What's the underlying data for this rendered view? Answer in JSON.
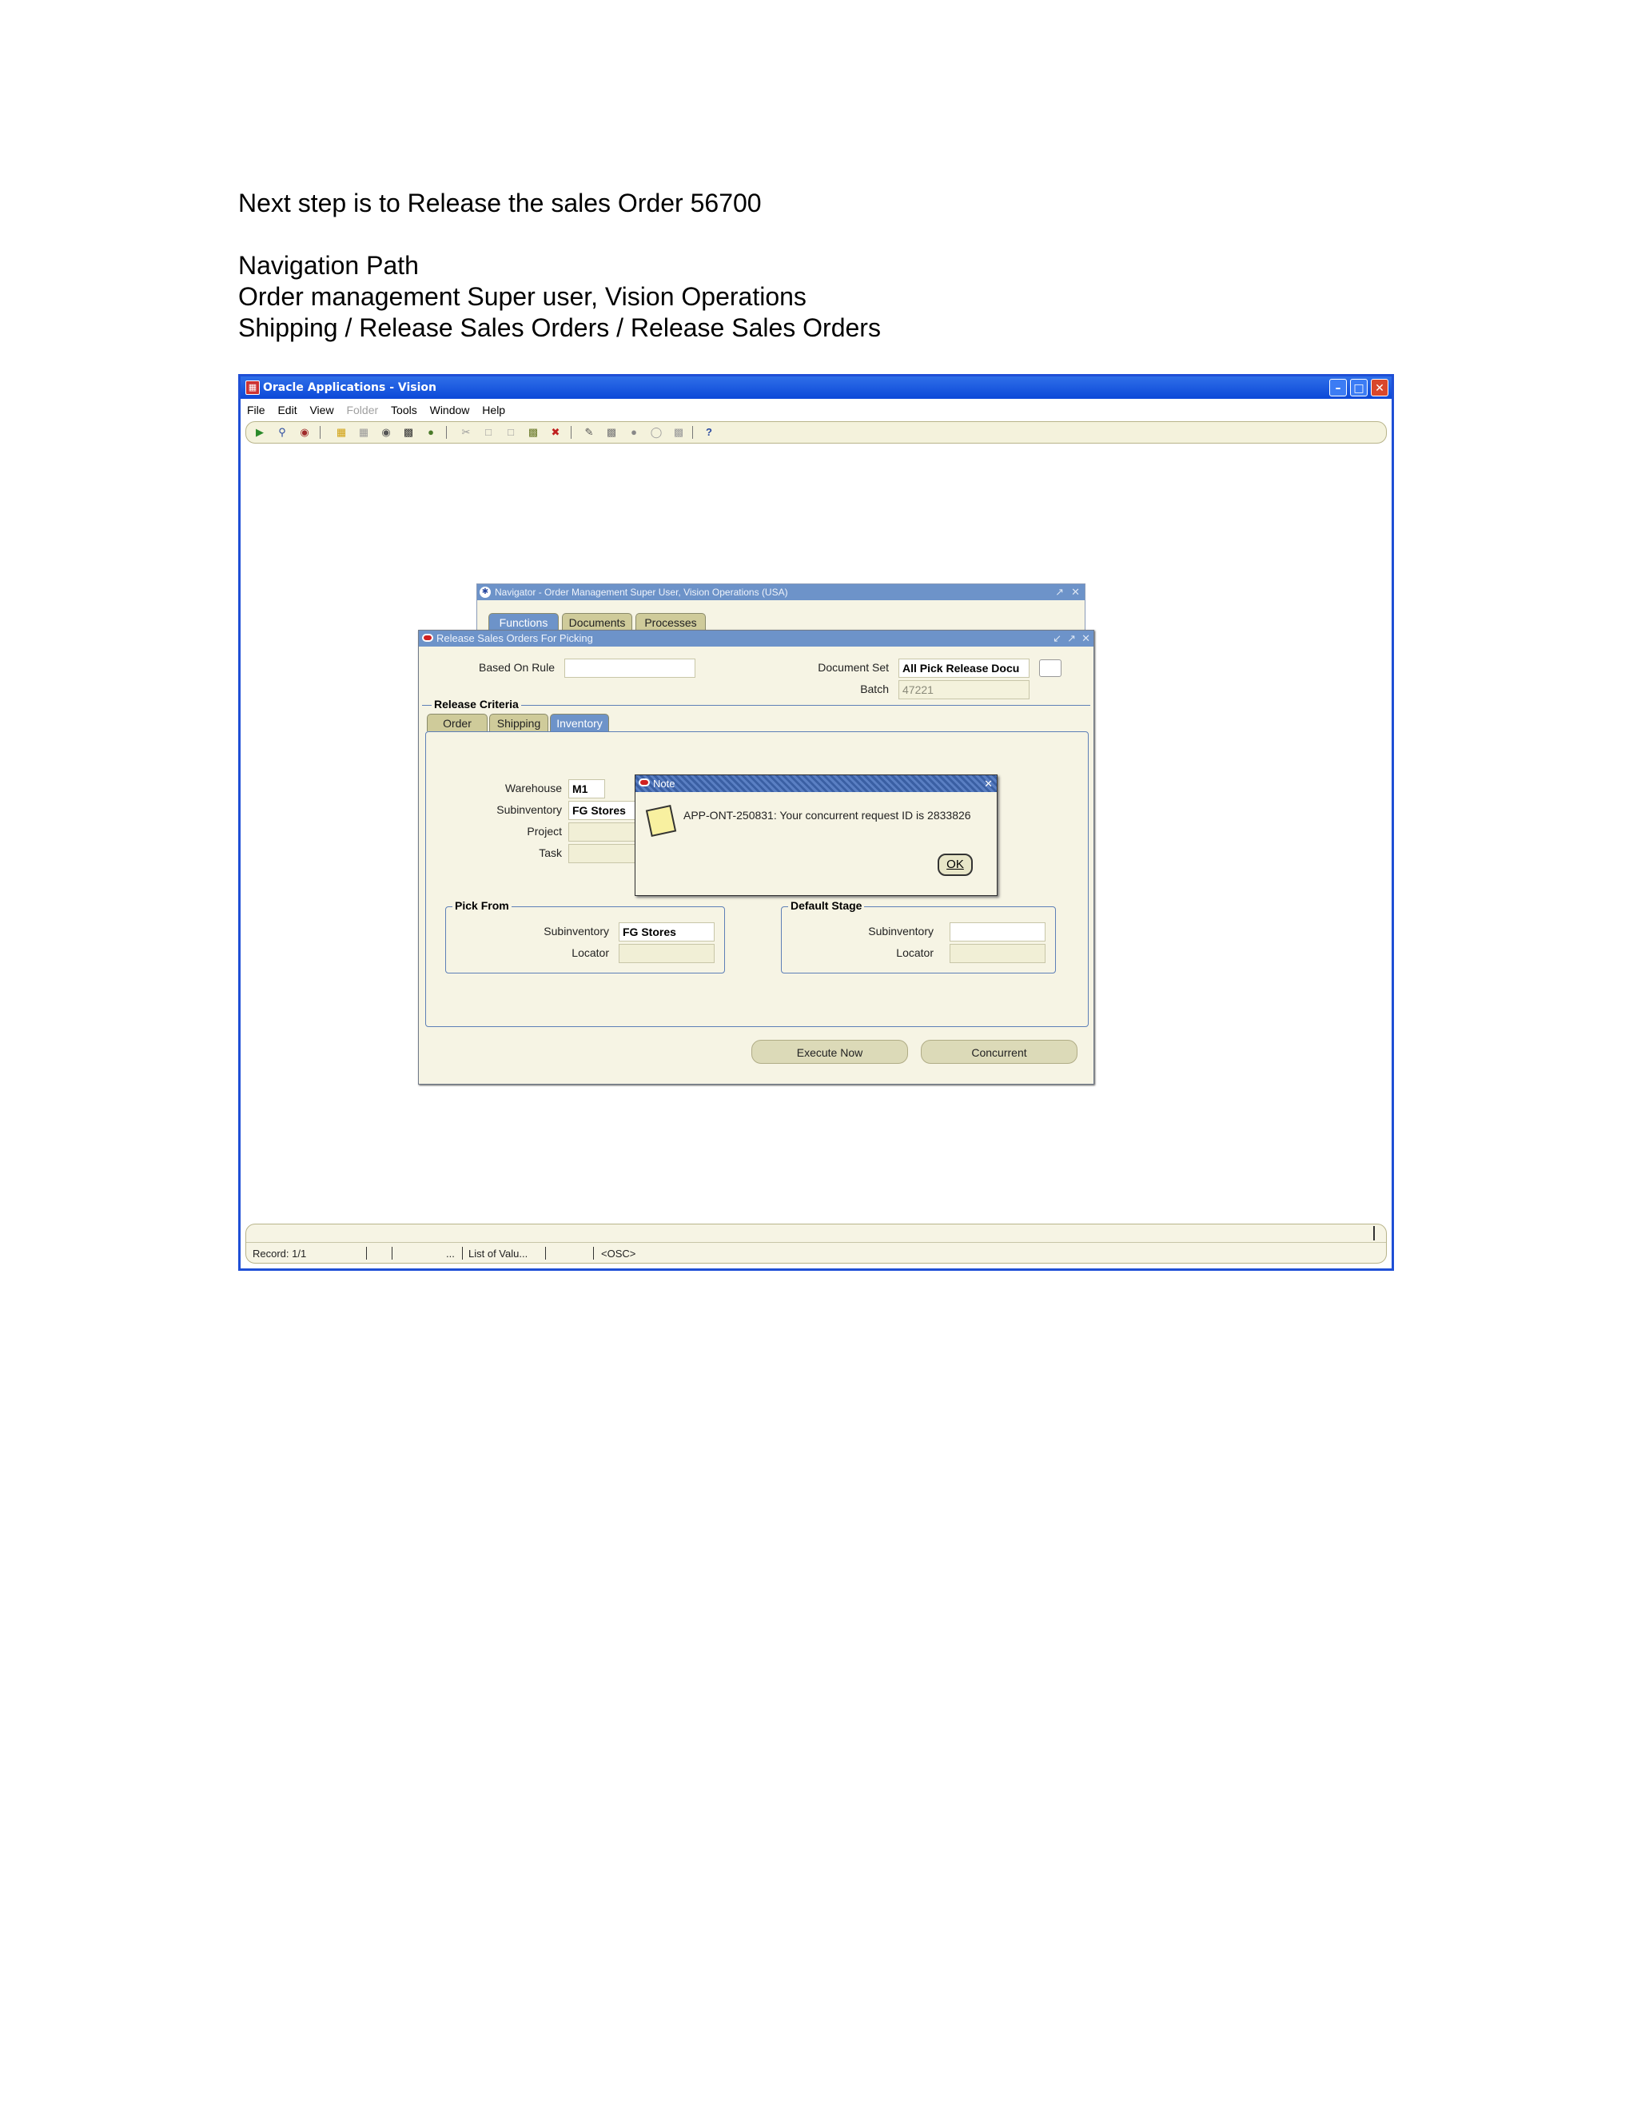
{
  "document": {
    "line1": "Next step is to Release the sales Order 56700",
    "line2": "Navigation Path",
    "line3": "Order management Super user, Vision Operations",
    "line4": "Shipping / Release Sales Orders / Release Sales Orders"
  },
  "app_window": {
    "title": "Oracle Applications - Vision",
    "menu": [
      "File",
      "Edit",
      "View",
      "Folder",
      "Tools",
      "Window",
      "Help"
    ],
    "help_glyph": "?"
  },
  "navigator": {
    "title": "Navigator - Order Management Super User, Vision Operations (USA)",
    "tabs": [
      "Functions",
      "Documents",
      "Processes"
    ]
  },
  "release_window": {
    "title": "Release Sales Orders For Picking",
    "based_on_rule_label": "Based On Rule",
    "based_on_rule_value": "",
    "document_set_label": "Document Set",
    "document_set_value": "All Pick Release Docu",
    "batch_label": "Batch",
    "batch_value": "47221",
    "release_criteria_label": "Release Criteria",
    "tabs": [
      "Order",
      "Shipping",
      "Inventory"
    ],
    "active_tab": "Inventory",
    "warehouse_label": "Warehouse",
    "warehouse_value": "M1",
    "subinventory_label": "Subinventory",
    "subinventory_value": "FG Stores",
    "project_label": "Project",
    "task_label": "Task",
    "pick_from": {
      "title": "Pick From",
      "subinventory_label": "Subinventory",
      "subinventory_value": "FG Stores",
      "locator_label": "Locator"
    },
    "default_stage": {
      "title": "Default Stage",
      "subinventory_label": "Subinventory",
      "locator_label": "Locator"
    },
    "execute_now_label": "Execute Now",
    "concurrent_label": "Concurrent"
  },
  "note_dialog": {
    "title": "Note",
    "message": "APP-ONT-250831: Your concurrent request ID is 2833826",
    "ok_label": "OK"
  },
  "status_bar": {
    "record": "Record: 1/1",
    "dots": "...",
    "list_of_values": "List of Valu...",
    "osc": "<OSC>"
  },
  "colors": {
    "window_border": "#1f4fd6",
    "inner_title": "#6d93c9",
    "form_background": "#f6f4e4"
  }
}
